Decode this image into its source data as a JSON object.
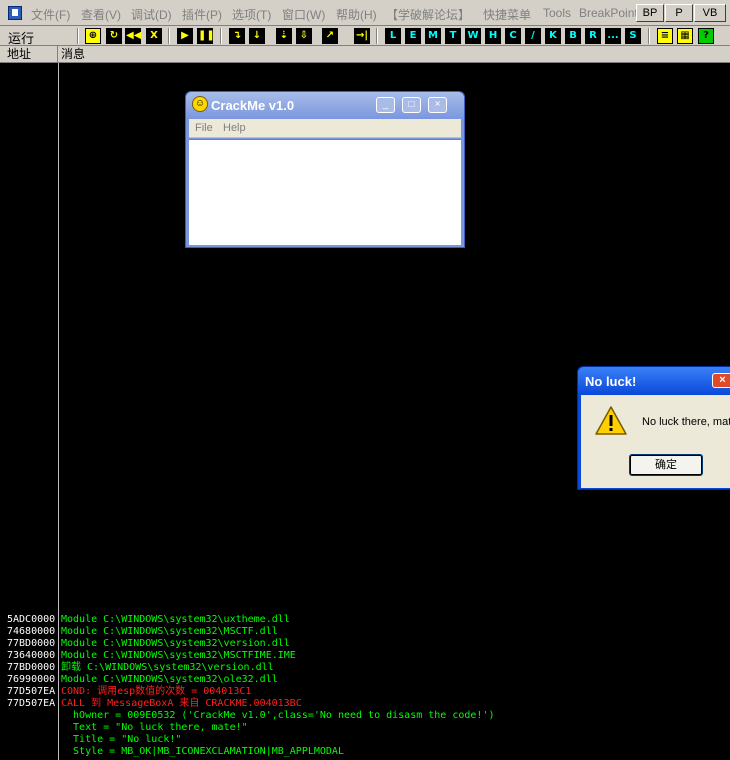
{
  "menubar": {
    "items": [
      "文件(F)",
      "查看(V)",
      "调试(D)",
      "插件(P)",
      "选项(T)",
      "窗口(W)",
      "帮助(H)",
      "【学破解论坛】",
      "快捷菜单",
      "Tools",
      "BreakPoint"
    ],
    "buttons": [
      "BP",
      "P",
      "VB"
    ]
  },
  "toolbar": {
    "status": "运行",
    "buttons": [
      "⊕",
      "↻",
      "◀◀",
      "X",
      "▶",
      "❚❚",
      "↴",
      "↓",
      "⇣",
      "⇩",
      "↗",
      "→|",
      "L",
      "E",
      "M",
      "T",
      "W",
      "H",
      "C",
      "/",
      "K",
      "B",
      "R",
      "...",
      "S",
      "≡",
      "▦",
      "?"
    ]
  },
  "columns": {
    "address": "地址",
    "message": "消息"
  },
  "crackme": {
    "title": "CrackMe v1.0",
    "menus": [
      "File",
      "Help"
    ]
  },
  "dialog": {
    "title": "No luck!",
    "message": "No luck there, mate!",
    "ok_label": "确定"
  },
  "log": [
    {
      "addr": "5ADC0000",
      "msg": "Module C:\\WINDOWS\\system32\\uxtheme.dll",
      "color": "green"
    },
    {
      "addr": "74680000",
      "msg": "Module C:\\WINDOWS\\system32\\MSCTF.dll",
      "color": "green"
    },
    {
      "addr": "77BD0000",
      "msg": "Module C:\\WINDOWS\\system32\\version.dll",
      "color": "green"
    },
    {
      "addr": "73640000",
      "msg": "Module C:\\WINDOWS\\system32\\MSCTFIME.IME",
      "color": "green"
    },
    {
      "addr": "77BD0000",
      "msg": "卸载 C:\\WINDOWS\\system32\\version.dll",
      "color": "green"
    },
    {
      "addr": "76990000",
      "msg": "Module C:\\WINDOWS\\system32\\ole32.dll",
      "color": "green"
    },
    {
      "addr": "77D507EA",
      "msg": "COND: 调用esp数值的次数 = 004013C1",
      "color": "red"
    },
    {
      "addr": "77D507EA",
      "msg": "CALL 到 MessageBoxA 来自 CRACKME.004013BC",
      "color": "red"
    },
    {
      "addr": "",
      "msg": "  hOwner = 009E0532 ('CrackMe v1.0',class='No need to disasm the code!')",
      "color": "green"
    },
    {
      "addr": "",
      "msg": "  Text = \"No luck there, mate!\"",
      "color": "green"
    },
    {
      "addr": "",
      "msg": "  Title = \"No luck!\"",
      "color": "green"
    },
    {
      "addr": "",
      "msg": "  Style = MB_OK|MB_ICONEXCLAMATION|MB_APPLMODAL",
      "color": "green"
    }
  ],
  "colors": {
    "log_green": "#00ff00",
    "log_red": "#ff2020",
    "background": "#000000"
  }
}
